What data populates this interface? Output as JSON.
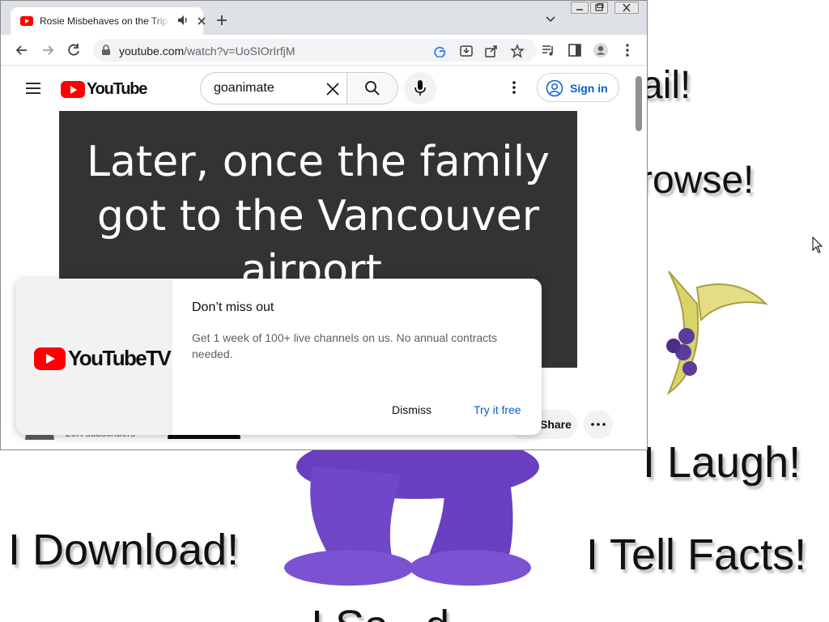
{
  "wallpaper": {
    "texts": [
      "ail!",
      "rowse!",
      "I Laugh!",
      "I Download!",
      "I Tell Facts!",
      "I Sa...d"
    ]
  },
  "browser": {
    "tab": {
      "title": "Rosie Misbehaves on the Trip"
    },
    "url_host": "youtube.com",
    "url_path": "/watch?v=UoSIOrIrfjM"
  },
  "youtube": {
    "logo_text": "YouTube",
    "search": {
      "value": "goanimate"
    },
    "signin_label": "Sign in",
    "video_caption": "Later, once the family got to the Vancouver airport,",
    "subscribers": "20K subscribers",
    "share_label": "Share"
  },
  "promo": {
    "logo_text": "YouTubeTV",
    "title": "Don’t miss out",
    "body": "Get 1 week of 100+ live channels on us. No annual contracts needed.",
    "dismiss_label": "Dismiss",
    "try_label": "Try it free"
  },
  "colors": {
    "youtube_red": "#ff0000",
    "link_blue": "#065fd4",
    "video_bg": "#333333"
  }
}
